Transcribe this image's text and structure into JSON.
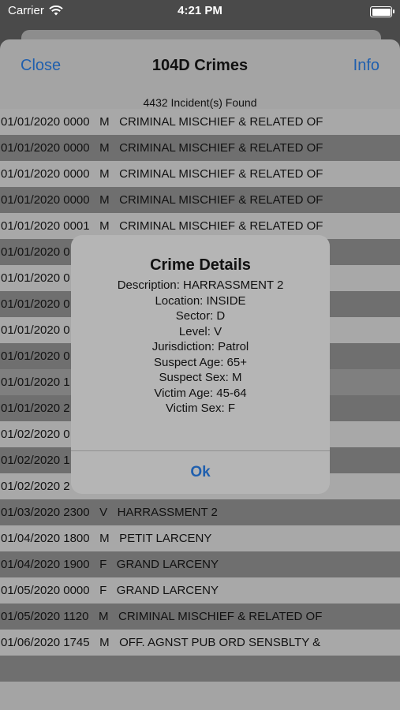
{
  "status": {
    "carrier": "Carrier",
    "time": "4:21 PM"
  },
  "nav": {
    "close": "Close",
    "title": "104D Crimes",
    "info": "Info"
  },
  "list": {
    "count": "4432 Incident(s) Found",
    "rows": [
      {
        "text": "01/01/2020 0000   M   CRIMINAL MISCHIEF & RELATED OF",
        "shade": "light"
      },
      {
        "text": "01/01/2020 0000   M   CRIMINAL MISCHIEF & RELATED OF",
        "shade": "dark"
      },
      {
        "text": "01/01/2020 0000   M   CRIMINAL MISCHIEF & RELATED OF",
        "shade": "light"
      },
      {
        "text": "01/01/2020 0000   M   CRIMINAL MISCHIEF & RELATED OF",
        "shade": "dark"
      },
      {
        "text": "01/01/2020 0001   M   CRIMINAL MISCHIEF & RELATED OF",
        "shade": "light"
      },
      {
        "text": "01/01/2020 0",
        "shade": "dark"
      },
      {
        "text": "01/01/2020 0",
        "shade": "light"
      },
      {
        "text": "01/01/2020 0",
        "shade": "dark"
      },
      {
        "text": "01/01/2020 0",
        "shade": "light"
      },
      {
        "text": "01/01/2020 0",
        "shade": "dark"
      },
      {
        "text": "01/01/2020 1",
        "shade": "selected"
      },
      {
        "text": "01/01/2020 2",
        "shade": "dark"
      },
      {
        "text": "01/02/2020 0",
        "shade": "light"
      },
      {
        "text": "01/02/2020 1",
        "shade": "dark"
      },
      {
        "text": "01/02/2020 2",
        "shade": "light"
      },
      {
        "text": "01/03/2020 2300   V   HARRASSMENT 2",
        "shade": "dark"
      },
      {
        "text": "01/04/2020 1800   M   PETIT LARCENY",
        "shade": "light"
      },
      {
        "text": "01/04/2020 1900   F   GRAND LARCENY",
        "shade": "dark"
      },
      {
        "text": "01/05/2020 0000   F   GRAND LARCENY",
        "shade": "light"
      },
      {
        "text": "01/05/2020 1120   M   CRIMINAL MISCHIEF & RELATED OF",
        "shade": "dark"
      },
      {
        "text": "01/06/2020 1745   M   OFF. AGNST PUB ORD SENSBLTY &",
        "shade": "light"
      },
      {
        "text": "",
        "shade": "dark"
      }
    ]
  },
  "alert": {
    "title": "Crime Details",
    "lines": [
      "Description: HARRASSMENT 2",
      "Location: INSIDE",
      "Sector: D",
      "Level: V",
      "Jurisdiction: Patrol",
      "Suspect Age: 65+",
      "Suspect Sex: M",
      "Victim Age: 45-64",
      "Victim Sex: F"
    ],
    "ok": "Ok"
  }
}
